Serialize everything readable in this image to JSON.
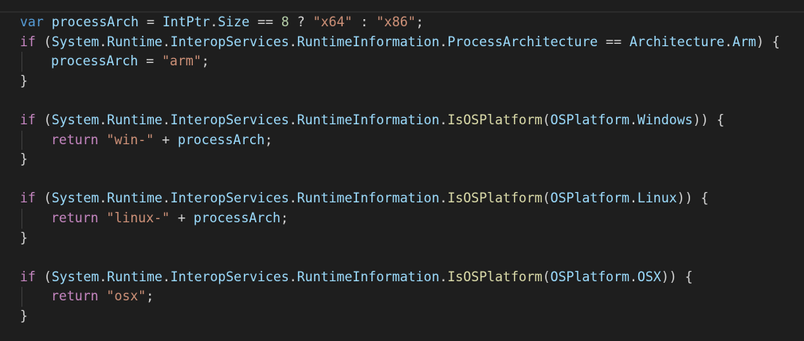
{
  "colors": {
    "background": "#1e1e1e",
    "keyword": "#569cd6",
    "control": "#c586c0",
    "variable": "#9cdcfe",
    "type": "#4ec9b0",
    "function": "#dcdcaa",
    "string": "#ce9178",
    "number": "#b5cea8",
    "default": "#d4d4d4"
  },
  "lines": [
    {
      "indent": false,
      "tokens": [
        {
          "t": "var",
          "c": "kw"
        },
        {
          "t": " ",
          "c": "op"
        },
        {
          "t": "processArch",
          "c": "var"
        },
        {
          "t": " = ",
          "c": "op"
        },
        {
          "t": "IntPtr",
          "c": "var"
        },
        {
          "t": ".",
          "c": "op"
        },
        {
          "t": "Size",
          "c": "var"
        },
        {
          "t": " == ",
          "c": "op"
        },
        {
          "t": "8",
          "c": "num"
        },
        {
          "t": " ? ",
          "c": "op"
        },
        {
          "t": "\"x64\"",
          "c": "str"
        },
        {
          "t": " : ",
          "c": "op"
        },
        {
          "t": "\"x86\"",
          "c": "str"
        },
        {
          "t": ";",
          "c": "op"
        }
      ]
    },
    {
      "indent": false,
      "tokens": [
        {
          "t": "if",
          "c": "ctl"
        },
        {
          "t": " (",
          "c": "op"
        },
        {
          "t": "System",
          "c": "var"
        },
        {
          "t": ".",
          "c": "op"
        },
        {
          "t": "Runtime",
          "c": "var"
        },
        {
          "t": ".",
          "c": "op"
        },
        {
          "t": "InteropServices",
          "c": "var"
        },
        {
          "t": ".",
          "c": "op"
        },
        {
          "t": "RuntimeInformation",
          "c": "var"
        },
        {
          "t": ".",
          "c": "op"
        },
        {
          "t": "ProcessArchitecture",
          "c": "var"
        },
        {
          "t": " == ",
          "c": "op"
        },
        {
          "t": "Architecture",
          "c": "var"
        },
        {
          "t": ".",
          "c": "op"
        },
        {
          "t": "Arm",
          "c": "var"
        },
        {
          "t": ") {",
          "c": "op"
        }
      ]
    },
    {
      "indent": true,
      "tokens": [
        {
          "t": "processArch",
          "c": "var"
        },
        {
          "t": " = ",
          "c": "op"
        },
        {
          "t": "\"arm\"",
          "c": "str"
        },
        {
          "t": ";",
          "c": "op"
        }
      ]
    },
    {
      "indent": false,
      "tokens": [
        {
          "t": "}",
          "c": "op"
        }
      ]
    },
    {
      "indent": false,
      "tokens": []
    },
    {
      "indent": false,
      "tokens": [
        {
          "t": "if",
          "c": "ctl"
        },
        {
          "t": " (",
          "c": "op"
        },
        {
          "t": "System",
          "c": "var"
        },
        {
          "t": ".",
          "c": "op"
        },
        {
          "t": "Runtime",
          "c": "var"
        },
        {
          "t": ".",
          "c": "op"
        },
        {
          "t": "InteropServices",
          "c": "var"
        },
        {
          "t": ".",
          "c": "op"
        },
        {
          "t": "RuntimeInformation",
          "c": "var"
        },
        {
          "t": ".",
          "c": "op"
        },
        {
          "t": "IsOSPlatform",
          "c": "fn"
        },
        {
          "t": "(",
          "c": "op"
        },
        {
          "t": "OSPlatform",
          "c": "var"
        },
        {
          "t": ".",
          "c": "op"
        },
        {
          "t": "Windows",
          "c": "var"
        },
        {
          "t": ")) {",
          "c": "op"
        }
      ]
    },
    {
      "indent": true,
      "tokens": [
        {
          "t": "return",
          "c": "ctl"
        },
        {
          "t": " ",
          "c": "op"
        },
        {
          "t": "\"win-\"",
          "c": "str"
        },
        {
          "t": " + ",
          "c": "op"
        },
        {
          "t": "processArch",
          "c": "var"
        },
        {
          "t": ";",
          "c": "op"
        }
      ]
    },
    {
      "indent": false,
      "tokens": [
        {
          "t": "}",
          "c": "op"
        }
      ]
    },
    {
      "indent": false,
      "tokens": []
    },
    {
      "indent": false,
      "tokens": [
        {
          "t": "if",
          "c": "ctl"
        },
        {
          "t": " (",
          "c": "op"
        },
        {
          "t": "System",
          "c": "var"
        },
        {
          "t": ".",
          "c": "op"
        },
        {
          "t": "Runtime",
          "c": "var"
        },
        {
          "t": ".",
          "c": "op"
        },
        {
          "t": "InteropServices",
          "c": "var"
        },
        {
          "t": ".",
          "c": "op"
        },
        {
          "t": "RuntimeInformation",
          "c": "var"
        },
        {
          "t": ".",
          "c": "op"
        },
        {
          "t": "IsOSPlatform",
          "c": "fn"
        },
        {
          "t": "(",
          "c": "op"
        },
        {
          "t": "OSPlatform",
          "c": "var"
        },
        {
          "t": ".",
          "c": "op"
        },
        {
          "t": "Linux",
          "c": "var"
        },
        {
          "t": ")) {",
          "c": "op"
        }
      ]
    },
    {
      "indent": true,
      "tokens": [
        {
          "t": "return",
          "c": "ctl"
        },
        {
          "t": " ",
          "c": "op"
        },
        {
          "t": "\"linux-\"",
          "c": "str"
        },
        {
          "t": " + ",
          "c": "op"
        },
        {
          "t": "processArch",
          "c": "var"
        },
        {
          "t": ";",
          "c": "op"
        }
      ]
    },
    {
      "indent": false,
      "tokens": [
        {
          "t": "}",
          "c": "op"
        }
      ]
    },
    {
      "indent": false,
      "tokens": []
    },
    {
      "indent": false,
      "tokens": [
        {
          "t": "if",
          "c": "ctl"
        },
        {
          "t": " (",
          "c": "op"
        },
        {
          "t": "System",
          "c": "var"
        },
        {
          "t": ".",
          "c": "op"
        },
        {
          "t": "Runtime",
          "c": "var"
        },
        {
          "t": ".",
          "c": "op"
        },
        {
          "t": "InteropServices",
          "c": "var"
        },
        {
          "t": ".",
          "c": "op"
        },
        {
          "t": "RuntimeInformation",
          "c": "var"
        },
        {
          "t": ".",
          "c": "op"
        },
        {
          "t": "IsOSPlatform",
          "c": "fn"
        },
        {
          "t": "(",
          "c": "op"
        },
        {
          "t": "OSPlatform",
          "c": "var"
        },
        {
          "t": ".",
          "c": "op"
        },
        {
          "t": "OSX",
          "c": "var"
        },
        {
          "t": ")) {",
          "c": "op"
        }
      ]
    },
    {
      "indent": true,
      "tokens": [
        {
          "t": "return",
          "c": "ctl"
        },
        {
          "t": " ",
          "c": "op"
        },
        {
          "t": "\"osx\"",
          "c": "str"
        },
        {
          "t": ";",
          "c": "op"
        }
      ]
    },
    {
      "indent": false,
      "tokens": [
        {
          "t": "}",
          "c": "op"
        }
      ]
    }
  ]
}
